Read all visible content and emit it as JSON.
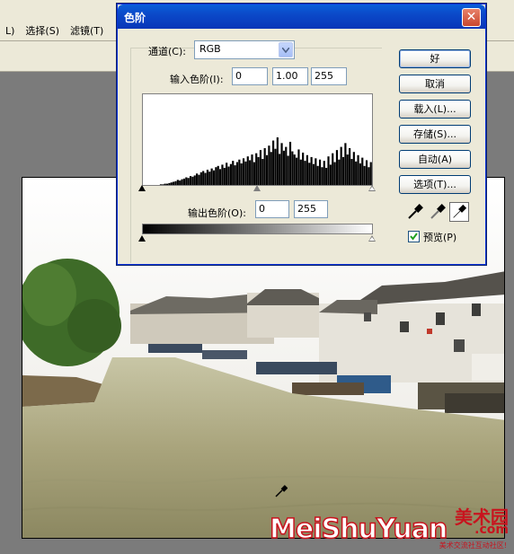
{
  "menubar": {
    "items": [
      "L)",
      "选择(S)",
      "滤镜(T)"
    ]
  },
  "dialog": {
    "title": "色阶",
    "close_label": "✕",
    "channel": {
      "label": "通道(C):",
      "value": "RGB"
    },
    "input_levels": {
      "label": "输入色阶(I):",
      "black": "0",
      "gamma": "1.00",
      "white": "255"
    },
    "output_levels": {
      "label": "输出色阶(O):",
      "black": "0",
      "white": "255"
    },
    "buttons": {
      "ok": "好",
      "cancel": "取消",
      "load": "载入(L)...",
      "save": "存储(S)...",
      "auto": "自动(A)",
      "options": "选项(T)..."
    },
    "preview": {
      "label": "预览(P)",
      "checked": true
    }
  },
  "histogram": {
    "bins": [
      0,
      0,
      0,
      0,
      0,
      0,
      0,
      0,
      1,
      1,
      2,
      2,
      3,
      4,
      5,
      6,
      8,
      7,
      9,
      10,
      12,
      11,
      14,
      13,
      15,
      18,
      16,
      20,
      22,
      19,
      24,
      21,
      26,
      23,
      28,
      30,
      25,
      32,
      27,
      35,
      29,
      33,
      38,
      31,
      36,
      40,
      34,
      42,
      37,
      45,
      39,
      48,
      36,
      50,
      44,
      55,
      41,
      58,
      47,
      62,
      52,
      70,
      57,
      75,
      49,
      66,
      54,
      60,
      46,
      68,
      53,
      48,
      43,
      56,
      40,
      51,
      38,
      47,
      35,
      44,
      33,
      42,
      30,
      40,
      28,
      38,
      27,
      45,
      32,
      50,
      36,
      55,
      40,
      60,
      44,
      66,
      48,
      58,
      41,
      52,
      37,
      47,
      34,
      43,
      30,
      39,
      28,
      36
    ]
  },
  "watermark": {
    "main": "MeiShuYuan",
    "cn": "美术园",
    "com": ".com",
    "sub": "美术交流社互动社区!"
  },
  "colors": {
    "dialog_bg": "#ece9d8",
    "titlebar": "#0a5fd8",
    "close_red": "#c9462e",
    "watermark_red": "#c8141e"
  }
}
